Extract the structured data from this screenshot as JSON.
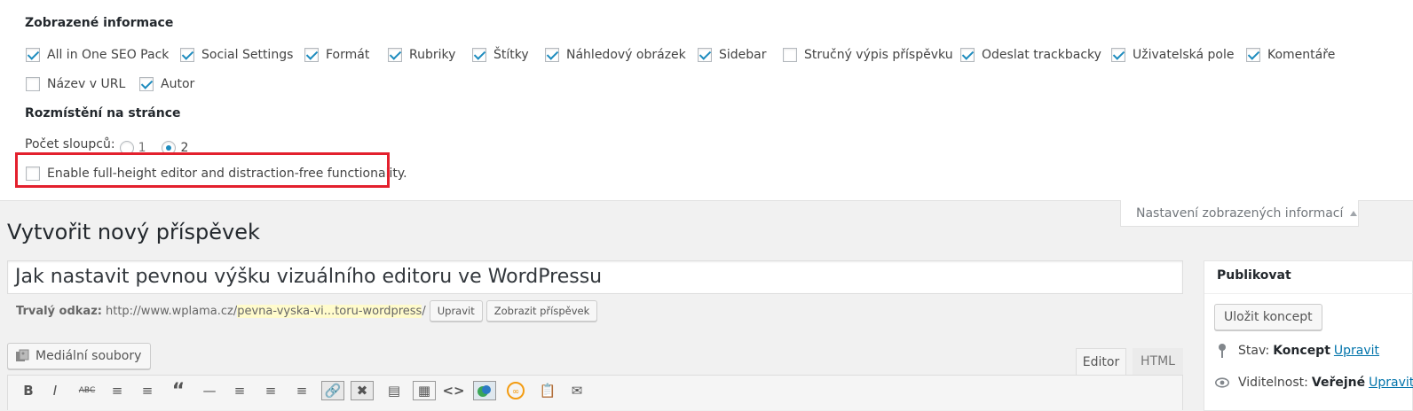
{
  "screen_options": {
    "shown_info_heading": "Zobrazené informace",
    "checkboxes": [
      {
        "label": "All in One SEO Pack",
        "checked": true
      },
      {
        "label": "Social Settings",
        "checked": true
      },
      {
        "label": "Formát",
        "checked": true
      },
      {
        "label": "Rubriky",
        "checked": true
      },
      {
        "label": "Štítky",
        "checked": true
      },
      {
        "label": "Náhledový obrázek",
        "checked": true
      },
      {
        "label": "Sidebar",
        "checked": true
      },
      {
        "label": "Stručný výpis příspěvku",
        "checked": false
      },
      {
        "label": "Odeslat trackbacky",
        "checked": true
      },
      {
        "label": "Uživatelská pole",
        "checked": true
      },
      {
        "label": "Komentáře",
        "checked": true
      },
      {
        "label": "Název v URL",
        "checked": false
      },
      {
        "label": "Autor",
        "checked": true
      }
    ],
    "layout_heading": "Rozmístění na stránce",
    "columns_label": "Počet sloupců:",
    "column_options": [
      "1",
      "2"
    ],
    "columns_selected": "2",
    "full_height_label": "Enable full-height editor and distraction-free functionality.",
    "full_height_checked": false,
    "toggle_tab_label": "Nastavení zobrazených informací"
  },
  "page_title": "Vytvořit nový příspěvek",
  "post_title_value": "Jak nastavit pevnou výšku vizuálního editoru ve WordPressu",
  "permalink": {
    "label": "Trvalý odkaz:",
    "base": "http://www.wplama.cz/",
    "slug": "pevna-vyska-vi...toru-wordpress",
    "trailing": "/",
    "edit_button": "Upravit",
    "view_button": "Zobrazit příspěvek"
  },
  "media_button": "Mediální soubory",
  "editor_tabs": {
    "visual": "Editor",
    "html": "HTML",
    "active": "Editor"
  },
  "toolbar_icons": [
    "bold-icon",
    "italic-icon",
    "strikethrough-icon",
    "bullet-list-icon",
    "numbered-list-icon",
    "blockquote-icon",
    "horizontal-rule-icon",
    "align-left-icon",
    "align-center-icon",
    "align-right-icon",
    "link-icon",
    "unlink-icon",
    "read-more-icon",
    "toolbar-toggle-icon",
    "code-icon",
    "plugin-icon",
    "infinity-icon",
    "paste-icon",
    "email-icon"
  ],
  "publish_box": {
    "title": "Publikovat",
    "save_draft": "Uložit koncept",
    "status_label": "Stav:",
    "status_value": "Koncept",
    "status_edit": "Upravit",
    "visibility_label": "Viditelnost:",
    "visibility_value": "Veřejné",
    "visibility_edit": "Upravit"
  },
  "colors": {
    "accent": "#1e8cbe",
    "highlight_border": "#e3202d",
    "link": "#0073aa"
  }
}
